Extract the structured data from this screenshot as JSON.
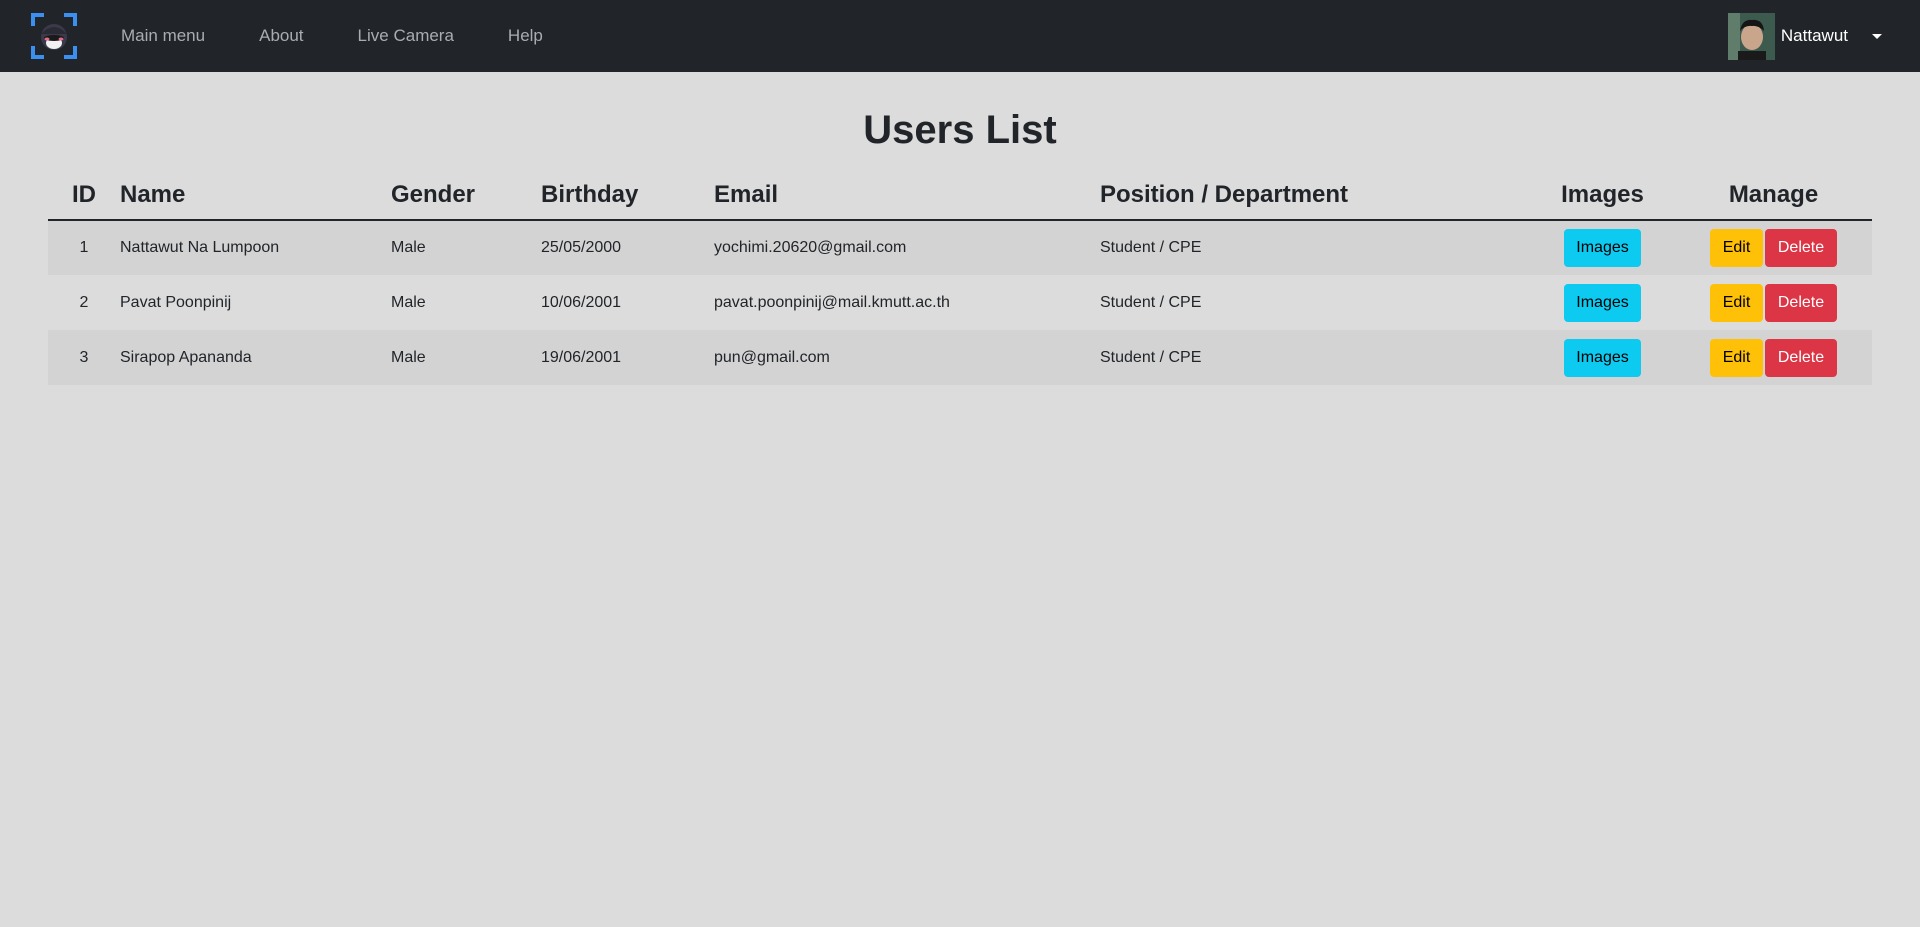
{
  "navbar": {
    "links": [
      "Main menu",
      "About",
      "Live Camera",
      "Help"
    ],
    "user": {
      "name": "Nattawut"
    }
  },
  "page": {
    "title": "Users List"
  },
  "table": {
    "headers": {
      "id": "ID",
      "name": "Name",
      "gender": "Gender",
      "birthday": "Birthday",
      "email": "Email",
      "position": "Position / Department",
      "images": "Images",
      "manage": "Manage"
    },
    "rows": [
      {
        "id": "1",
        "name": "Nattawut Na Lumpoon",
        "gender": "Male",
        "birthday": "25/05/2000",
        "email": "yochimi.20620@gmail.com",
        "position": "Student / CPE",
        "images_label": "Images",
        "edit_label": "Edit",
        "delete_label": "Delete"
      },
      {
        "id": "2",
        "name": "Pavat Poonpinij",
        "gender": "Male",
        "birthday": "10/06/2001",
        "email": "pavat.poonpinij@mail.kmutt.ac.th",
        "position": "Student / CPE",
        "images_label": "Images",
        "edit_label": "Edit",
        "delete_label": "Delete"
      },
      {
        "id": "3",
        "name": "Sirapop Apananda",
        "gender": "Male",
        "birthday": "19/06/2001",
        "email": "pun@gmail.com",
        "position": "Student / CPE",
        "images_label": "Images",
        "edit_label": "Edit",
        "delete_label": "Delete"
      }
    ]
  },
  "colors": {
    "navbar_bg": "#212529",
    "page_bg": "#dcdcdc",
    "info": "#0dcaf0",
    "warning": "#ffc107",
    "danger": "#dc3545"
  },
  "icons": {
    "brand": "face-scan-logo-icon",
    "user_menu_caret": "caret-down-icon"
  }
}
